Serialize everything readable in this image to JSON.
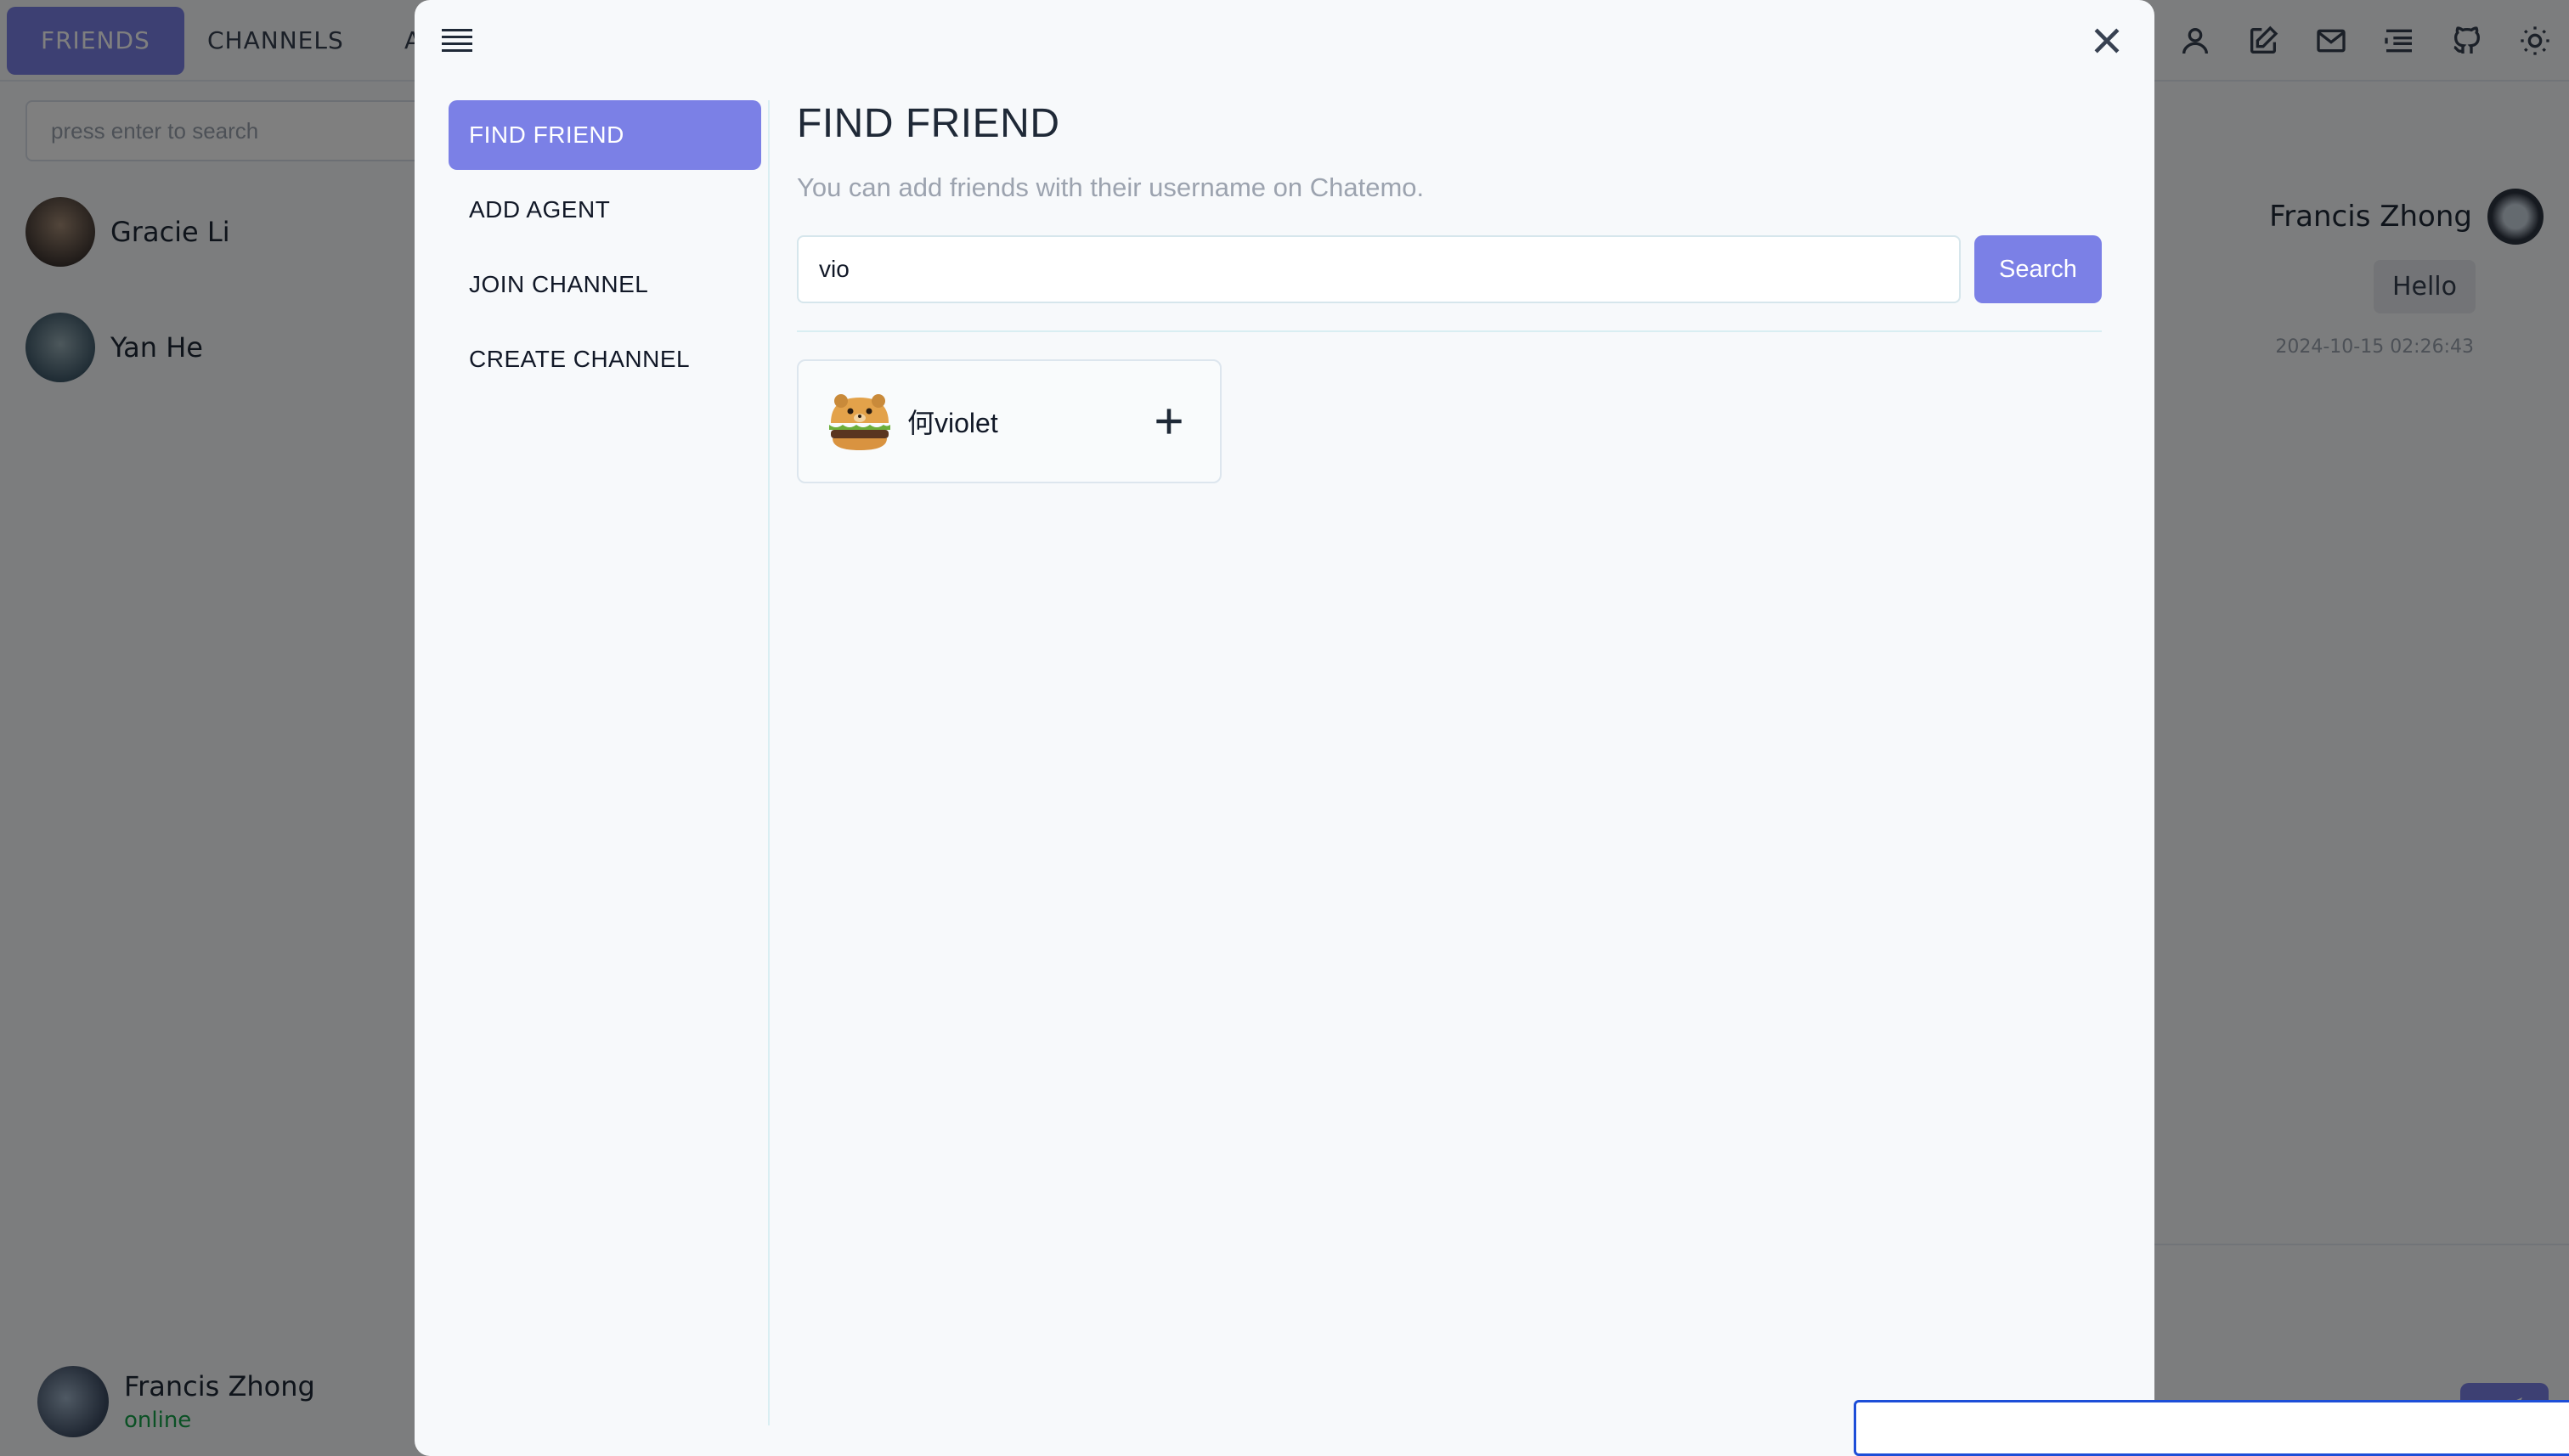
{
  "app": {
    "tabs": [
      {
        "label": "FRIENDS",
        "active": true
      },
      {
        "label": "CHANNELS",
        "active": false
      },
      {
        "label": "A",
        "active": false
      }
    ],
    "top_icons": [
      "user-icon",
      "edit-icon",
      "mail-icon",
      "list-icon",
      "github-icon",
      "sun-icon"
    ],
    "search_placeholder": "press enter to search",
    "friends": [
      {
        "name": "Gracie Li"
      },
      {
        "name": "Yan He"
      }
    ],
    "current_user": {
      "name": "Francis Zhong",
      "status": "online"
    },
    "chat": {
      "peer_name": "Francis Zhong",
      "message": "Hello",
      "timestamp": "2024-10-15 02:26:43"
    },
    "accent_color": "#7b80e6"
  },
  "modal": {
    "menu": [
      {
        "label": "FIND FRIEND",
        "active": true
      },
      {
        "label": "ADD AGENT",
        "active": false
      },
      {
        "label": "JOIN CHANNEL",
        "active": false
      },
      {
        "label": "CREATE CHANNEL",
        "active": false
      }
    ],
    "title": "FIND FRIEND",
    "subtitle": "You can add friends with their username on Chatemo.",
    "search_value": "vio",
    "search_button": "Search",
    "results": [
      {
        "name": "何violet",
        "avatar": "bear-burger-avatar"
      }
    ]
  }
}
